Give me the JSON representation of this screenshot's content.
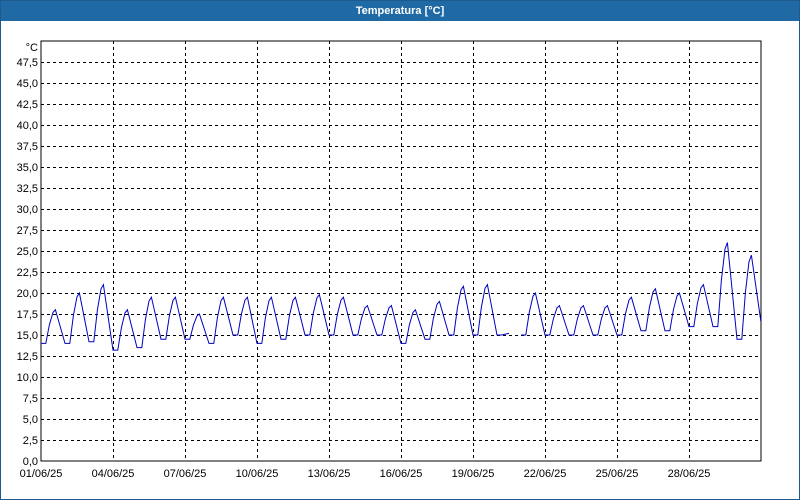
{
  "window": {
    "title": "Temperatura [°C]"
  },
  "chart_data": {
    "type": "line",
    "title": "Temperatura [°C]",
    "ylabel": "°C",
    "xlabel": "",
    "ylim": [
      0,
      50
    ],
    "xlim": [
      "01/06/25",
      "01/07/25"
    ],
    "grid": true,
    "y_ticks": [
      "0,0",
      "2,5",
      "5,0",
      "7,5",
      "10,0",
      "12,5",
      "15,0",
      "17,5",
      "20,0",
      "22,5",
      "25,0",
      "27,5",
      "30,0",
      "32,5",
      "35,0",
      "37,5",
      "40,0",
      "42,5",
      "45,0",
      "47,5"
    ],
    "x_ticks": [
      "01/06/25",
      "04/06/25",
      "07/06/25",
      "10/06/25",
      "13/06/25",
      "16/06/25",
      "19/06/25",
      "22/06/25",
      "25/06/25",
      "28/06/25"
    ],
    "colors": {
      "series": "#0000c0",
      "grid": "#000000"
    },
    "series": [
      {
        "name": "",
        "daily": [
          {
            "date": "01/06/25",
            "min": 14.0,
            "max": 18.0
          },
          {
            "date": "02/06/25",
            "min": 14.0,
            "max": 20.0
          },
          {
            "date": "03/06/25",
            "min": 14.2,
            "max": 21.0
          },
          {
            "date": "04/06/25",
            "min": 13.2,
            "max": 18.0
          },
          {
            "date": "05/06/25",
            "min": 13.5,
            "max": 19.5
          },
          {
            "date": "06/06/25",
            "min": 14.5,
            "max": 19.5
          },
          {
            "date": "07/06/25",
            "min": 14.5,
            "max": 17.5
          },
          {
            "date": "08/06/25",
            "min": 14.0,
            "max": 19.5
          },
          {
            "date": "09/06/25",
            "min": 15.0,
            "max": 19.5
          },
          {
            "date": "10/06/25",
            "min": 14.0,
            "max": 19.5
          },
          {
            "date": "11/06/25",
            "min": 14.5,
            "max": 19.5
          },
          {
            "date": "12/06/25",
            "min": 15.0,
            "max": 19.8
          },
          {
            "date": "13/06/25",
            "min": 15.0,
            "max": 19.5
          },
          {
            "date": "14/06/25",
            "min": 15.0,
            "max": 18.5
          },
          {
            "date": "15/06/25",
            "min": 15.0,
            "max": 18.5
          },
          {
            "date": "16/06/25",
            "min": 14.0,
            "max": 18.0
          },
          {
            "date": "17/06/25",
            "min": 14.5,
            "max": 19.0
          },
          {
            "date": "18/06/25",
            "min": 15.0,
            "max": 20.8
          },
          {
            "date": "19/06/25",
            "min": 15.0,
            "max": 21.0
          },
          {
            "date": "20/06/25",
            "min": 15.0,
            "max": 15.2
          },
          {
            "date": "21/06/25",
            "min": 15.0,
            "max": 20.0
          },
          {
            "date": "22/06/25",
            "min": 15.0,
            "max": 18.5
          },
          {
            "date": "23/06/25",
            "min": 15.0,
            "max": 18.5
          },
          {
            "date": "24/06/25",
            "min": 15.0,
            "max": 18.5
          },
          {
            "date": "25/06/25",
            "min": 15.0,
            "max": 19.5
          },
          {
            "date": "26/06/25",
            "min": 15.5,
            "max": 20.5
          },
          {
            "date": "27/06/25",
            "min": 15.5,
            "max": 20.0
          },
          {
            "date": "28/06/25",
            "min": 16.0,
            "max": 21.0
          },
          {
            "date": "29/06/25",
            "min": 16.0,
            "max": 26.0
          },
          {
            "date": "30/06/25",
            "min": 14.5,
            "max": 24.5
          },
          {
            "date": "01/07/25",
            "min": 16.5,
            "max": 20.5
          }
        ]
      }
    ]
  }
}
